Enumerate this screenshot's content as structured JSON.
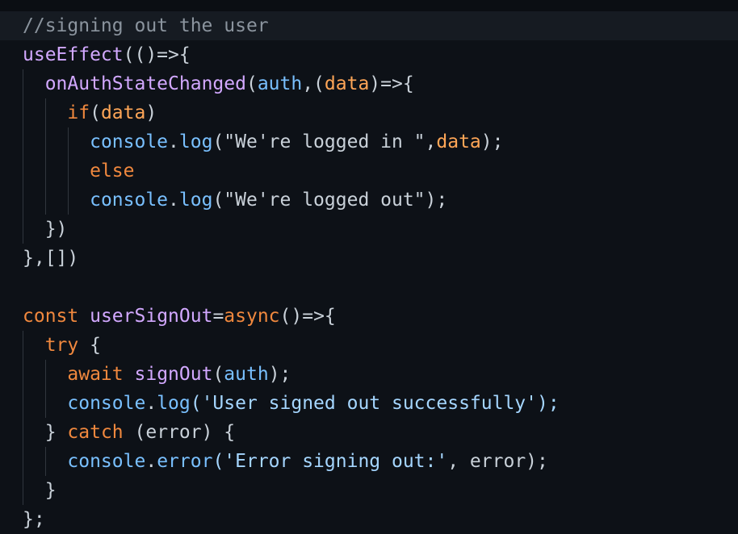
{
  "editor": {
    "lines": [
      {
        "highlight": true,
        "indent": 0,
        "tokens": [
          {
            "t": "//signing out the user",
            "c": "c-comment"
          }
        ]
      },
      {
        "indent": 0,
        "tokens": [
          {
            "t": "useEffect",
            "c": "c-fn"
          },
          {
            "t": "(()=>{",
            "c": "c-plain"
          }
        ]
      },
      {
        "indent": 1,
        "tokens": [
          {
            "t": "onAuthStateChanged",
            "c": "c-fn"
          },
          {
            "t": "(",
            "c": "c-plain"
          },
          {
            "t": "auth",
            "c": "c-var"
          },
          {
            "t": ",(",
            "c": "c-plain"
          },
          {
            "t": "data",
            "c": "c-param"
          },
          {
            "t": ")=>{",
            "c": "c-plain"
          }
        ]
      },
      {
        "indent": 2,
        "tokens": [
          {
            "t": "if",
            "c": "c-kw2"
          },
          {
            "t": "(",
            "c": "c-plain"
          },
          {
            "t": "data",
            "c": "c-param"
          },
          {
            "t": ")",
            "c": "c-plain"
          }
        ]
      },
      {
        "indent": 3,
        "tokens": [
          {
            "t": "console",
            "c": "c-var"
          },
          {
            "t": ".",
            "c": "c-plain"
          },
          {
            "t": "log",
            "c": "c-var"
          },
          {
            "t": "(\"We're logged in \",",
            "c": "c-plain"
          },
          {
            "t": "data",
            "c": "c-param"
          },
          {
            "t": ");",
            "c": "c-plain"
          }
        ]
      },
      {
        "indent": 3,
        "tokens": [
          {
            "t": "else",
            "c": "c-kw2"
          }
        ]
      },
      {
        "indent": 3,
        "tokens": [
          {
            "t": "console",
            "c": "c-var"
          },
          {
            "t": ".",
            "c": "c-plain"
          },
          {
            "t": "log",
            "c": "c-var"
          },
          {
            "t": "(\"We're logged out\");",
            "c": "c-plain"
          }
        ]
      },
      {
        "indent": 1,
        "tokens": [
          {
            "t": "})",
            "c": "c-plain"
          }
        ]
      },
      {
        "indent": 0,
        "tokens": [
          {
            "t": "},[])",
            "c": "c-plain"
          }
        ]
      },
      {
        "indent": 0,
        "tokens": [
          {
            "t": "",
            "c": "c-plain"
          }
        ]
      },
      {
        "indent": 0,
        "tokens": [
          {
            "t": "const",
            "c": "c-kw2"
          },
          {
            "t": " ",
            "c": "c-plain"
          },
          {
            "t": "userSignOut",
            "c": "c-fn"
          },
          {
            "t": "=",
            "c": "c-plain"
          },
          {
            "t": "async",
            "c": "c-kw2"
          },
          {
            "t": "()=>{",
            "c": "c-plain"
          }
        ]
      },
      {
        "indent": 1,
        "tokens": [
          {
            "t": "try",
            "c": "c-kw2"
          },
          {
            "t": " {",
            "c": "c-plain"
          }
        ]
      },
      {
        "indent": 2,
        "tokens": [
          {
            "t": "await",
            "c": "c-kw2"
          },
          {
            "t": " ",
            "c": "c-plain"
          },
          {
            "t": "signOut",
            "c": "c-fn"
          },
          {
            "t": "(",
            "c": "c-plain"
          },
          {
            "t": "auth",
            "c": "c-var"
          },
          {
            "t": ");",
            "c": "c-plain"
          }
        ]
      },
      {
        "indent": 2,
        "tokens": [
          {
            "t": "console",
            "c": "c-var"
          },
          {
            "t": ".",
            "c": "c-plain"
          },
          {
            "t": "log",
            "c": "c-var"
          },
          {
            "t": "('User signed out successfully');",
            "c": "c-str"
          }
        ]
      },
      {
        "indent": 1,
        "tokens": [
          {
            "t": "} ",
            "c": "c-plain"
          },
          {
            "t": "catch",
            "c": "c-kw2"
          },
          {
            "t": " (error) {",
            "c": "c-plain"
          }
        ]
      },
      {
        "indent": 2,
        "tokens": [
          {
            "t": "console",
            "c": "c-var"
          },
          {
            "t": ".",
            "c": "c-plain"
          },
          {
            "t": "error",
            "c": "c-var"
          },
          {
            "t": "('Error signing out:'",
            "c": "c-str"
          },
          {
            "t": ", error);",
            "c": "c-plain"
          }
        ]
      },
      {
        "indent": 1,
        "tokens": [
          {
            "t": "}",
            "c": "c-plain"
          }
        ]
      },
      {
        "indent": 0,
        "tokens": [
          {
            "t": "};",
            "c": "c-plain"
          }
        ]
      }
    ]
  }
}
